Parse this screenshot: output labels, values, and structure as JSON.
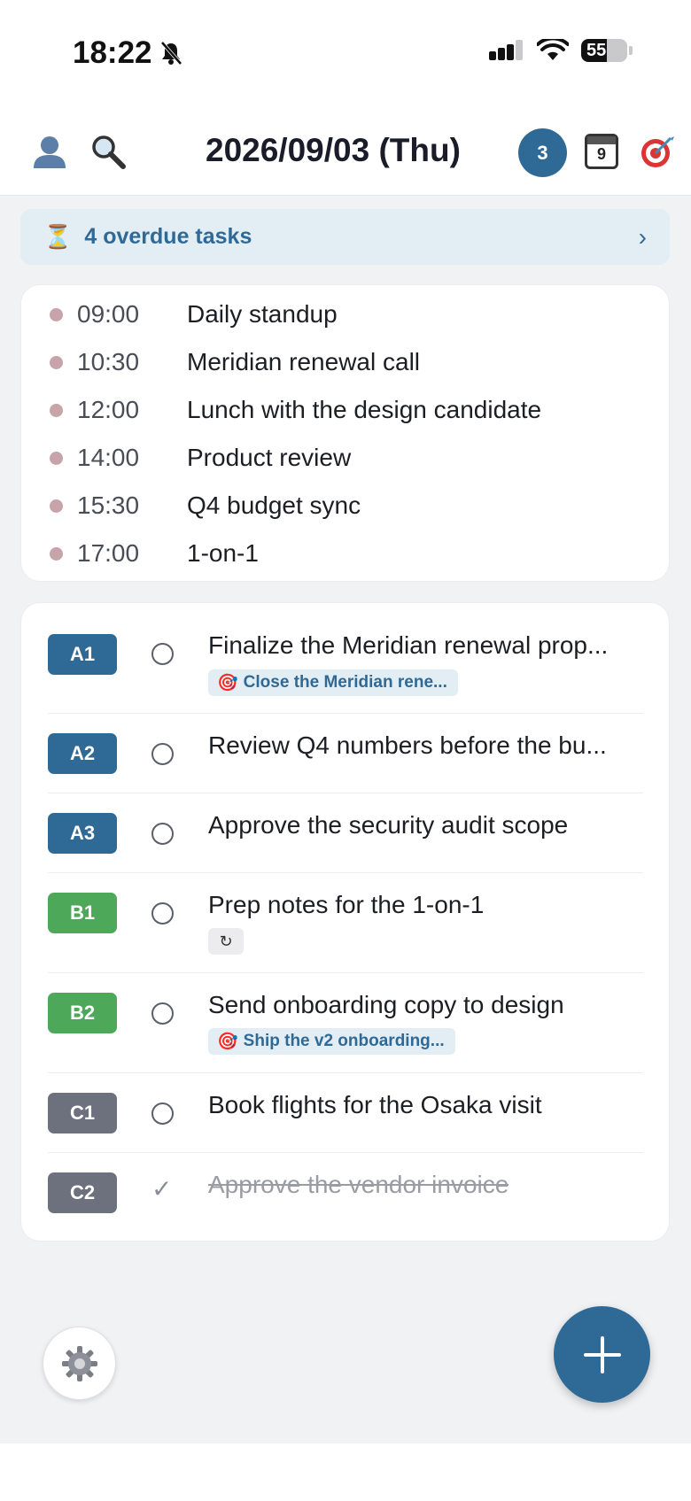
{
  "status_bar": {
    "time": "18:22",
    "battery": "55"
  },
  "header": {
    "date_title": "2026/09/03 (Thu)",
    "count_badge": "3",
    "calendar_day": "9"
  },
  "overdue": {
    "label": "4 overdue tasks",
    "chevron": "›"
  },
  "events": [
    {
      "time": "09:00",
      "title": "Daily standup"
    },
    {
      "time": "10:30",
      "title": "Meridian renewal call"
    },
    {
      "time": "12:00",
      "title": "Lunch with the design candidate"
    },
    {
      "time": "14:00",
      "title": "Product review"
    },
    {
      "time": "15:30",
      "title": "Q4 budget sync"
    },
    {
      "time": "17:00",
      "title": "1-on-1"
    }
  ],
  "tasks": [
    {
      "priority": "A1",
      "title": "Finalize the Meridian renewal prop...",
      "goal": "Close the Meridian rene...",
      "done": false
    },
    {
      "priority": "A2",
      "title": "Review Q4 numbers before the bu...",
      "done": false
    },
    {
      "priority": "A3",
      "title": "Approve the security audit scope",
      "done": false
    },
    {
      "priority": "B1",
      "title": "Prep notes for the 1-on-1",
      "repeat": true,
      "done": false
    },
    {
      "priority": "B2",
      "title": "Send onboarding copy to design",
      "goal": "Ship the v2 onboarding...",
      "done": false
    },
    {
      "priority": "C1",
      "title": "Book flights for the Osaka visit",
      "done": false
    },
    {
      "priority": "C2",
      "title": "Approve the vendor invoice",
      "done": true
    }
  ],
  "icons": {
    "profile": "person-icon",
    "search": "magnifier-icon",
    "calendar": "calendar-icon",
    "goals": "target-icon",
    "settings": "gear-icon",
    "add": "plus-icon"
  },
  "colors": {
    "accent": "#2f6a97",
    "priority_a": "#2f6a97",
    "priority_b": "#4ea85a",
    "priority_c": "#6c717d",
    "event_dot": "#c7a3aa",
    "banner_bg": "#e3edf4"
  }
}
